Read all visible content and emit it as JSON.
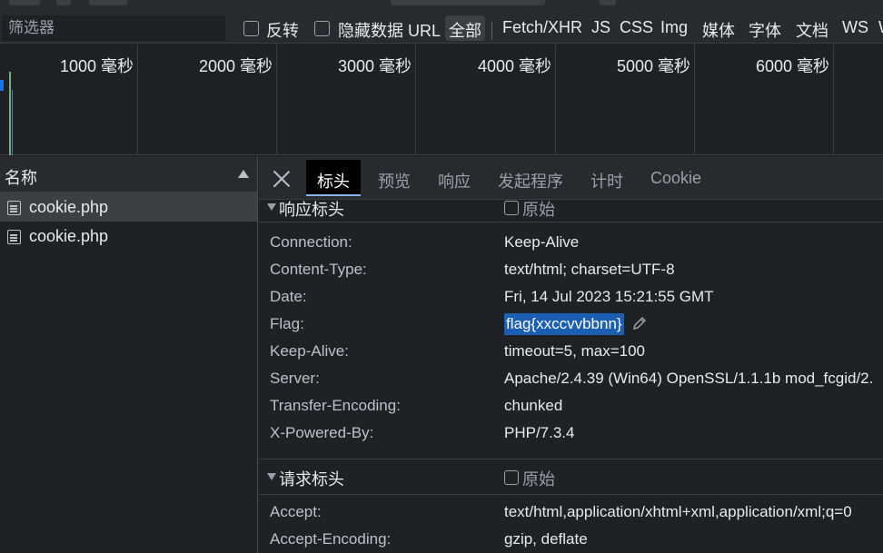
{
  "filter": {
    "placeholder": "筛选器",
    "invert_label": "反转",
    "hide_data_url_label": "隐藏数据 URL",
    "types": [
      "全部",
      "Fetch/XHR",
      "JS",
      "CSS",
      "Img",
      "媒体",
      "字体",
      "文档",
      "WS",
      "W"
    ]
  },
  "timeline": {
    "labels": [
      "1000 毫秒",
      "2000 毫秒",
      "3000 毫秒",
      "4000 毫秒",
      "5000 毫秒",
      "6000 毫秒"
    ]
  },
  "requests": {
    "column_name": "名称",
    "items": [
      {
        "name": "cookie.php",
        "selected": true
      },
      {
        "name": "cookie.php",
        "selected": false
      }
    ]
  },
  "details": {
    "tabs": [
      "标头",
      "预览",
      "响应",
      "发起程序",
      "计时",
      "Cookie"
    ],
    "active_tab": "标头",
    "response_section": {
      "title": "响应标头",
      "raw_label": "原始",
      "headers": [
        {
          "key": "Connection:",
          "value": "Keep-Alive"
        },
        {
          "key": "Content-Type:",
          "value": "text/html; charset=UTF-8"
        },
        {
          "key": "Date:",
          "value": "Fri, 14 Jul 2023 15:21:55 GMT"
        },
        {
          "key": "Flag:",
          "value": "flag{xxccvvbbnn}"
        },
        {
          "key": "Keep-Alive:",
          "value": "timeout=5, max=100"
        },
        {
          "key": "Server:",
          "value": "Apache/2.4.39 (Win64) OpenSSL/1.1.1b mod_fcgid/2."
        },
        {
          "key": "Transfer-Encoding:",
          "value": "chunked"
        },
        {
          "key": "X-Powered-By:",
          "value": "PHP/7.3.4"
        }
      ]
    },
    "request_section": {
      "title": "请求标头",
      "raw_label": "原始",
      "headers": [
        {
          "key": "Accept:",
          "value": "text/html,application/xhtml+xml,application/xml;q=0"
        },
        {
          "key": "Accept-Encoding:",
          "value": "gzip, deflate"
        }
      ]
    }
  },
  "colors": {
    "background": "#202124",
    "selection": "#1a5fb4",
    "accent": "#8ab4f8"
  }
}
